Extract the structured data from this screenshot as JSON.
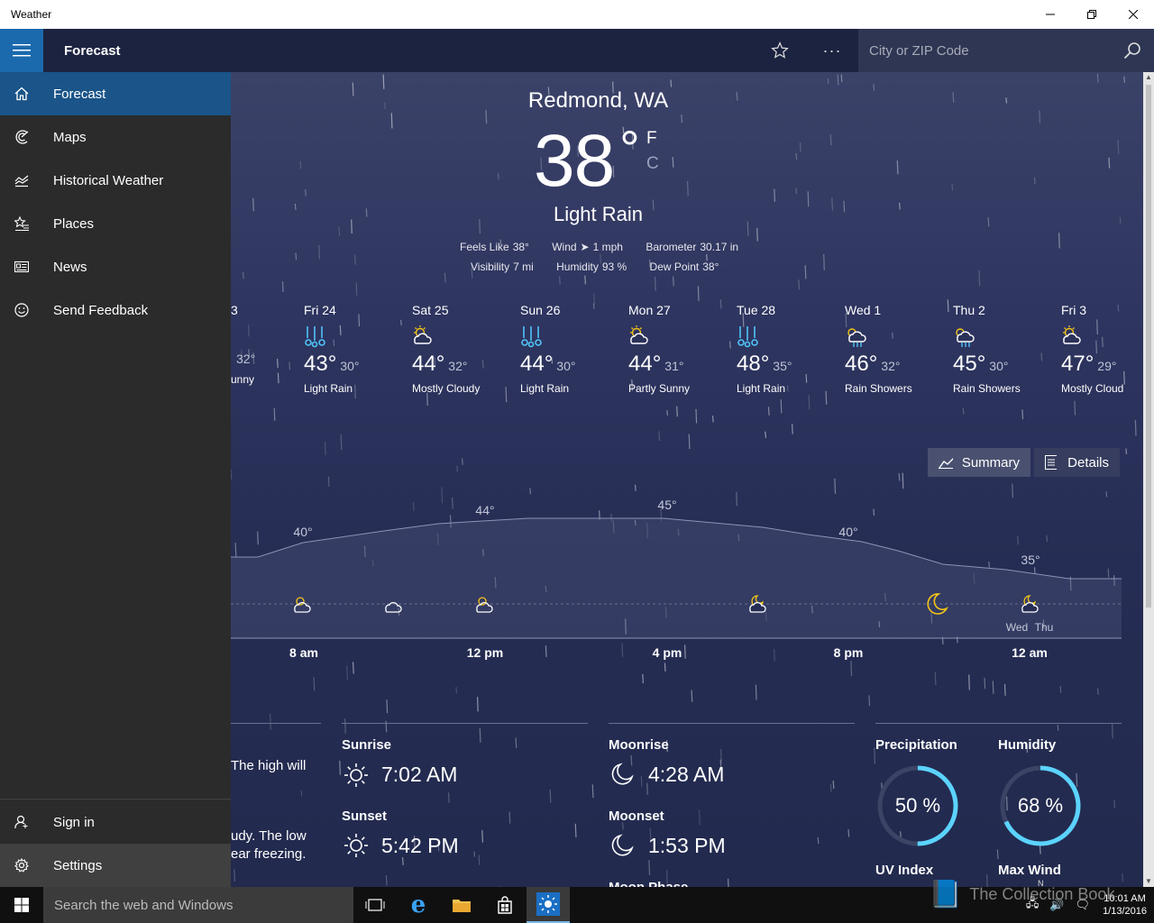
{
  "window": {
    "title": "Weather"
  },
  "header": {
    "title": "Forecast",
    "search_placeholder": "City or ZIP Code"
  },
  "nav": {
    "items": [
      {
        "label": "Forecast"
      },
      {
        "label": "Maps"
      },
      {
        "label": "Historical Weather"
      },
      {
        "label": "Places"
      },
      {
        "label": "News"
      },
      {
        "label": "Send Feedback"
      }
    ],
    "sign_in": "Sign in",
    "settings": "Settings"
  },
  "current": {
    "location": "Redmond, WA",
    "temperature": "38",
    "degree": "°",
    "unit_f": "F",
    "unit_c": "C",
    "condition": "Light Rain",
    "feels_like_label": "Feels Like",
    "feels_like": "38°",
    "wind_label": "Wind",
    "wind": "1 mph",
    "barometer_label": "Barometer",
    "barometer": "30.17 in",
    "visibility_label": "Visibility",
    "visibility": "7 mi",
    "humidity_label": "Humidity",
    "humidity": "93 %",
    "dew_point_label": "Dew Point",
    "dew_point": "38°"
  },
  "daily": [
    {
      "day": "3",
      "hi": "",
      "lo": "32°",
      "cond": "unny",
      "icon": "partly-sunny-icon"
    },
    {
      "day": "Fri 24",
      "hi": "43°",
      "lo": "30°",
      "cond": "Light Rain",
      "icon": "rain-icon"
    },
    {
      "day": "Sat 25",
      "hi": "44°",
      "lo": "32°",
      "cond": "Mostly Cloudy",
      "icon": "partly-cloudy-icon"
    },
    {
      "day": "Sun 26",
      "hi": "44°",
      "lo": "30°",
      "cond": "Light Rain",
      "icon": "rain-icon"
    },
    {
      "day": "Mon 27",
      "hi": "44°",
      "lo": "31°",
      "cond": "Partly Sunny",
      "icon": "partly-sunny-icon"
    },
    {
      "day": "Tue 28",
      "hi": "48°",
      "lo": "35°",
      "cond": "Light Rain",
      "icon": "rain-icon"
    },
    {
      "day": "Wed 1",
      "hi": "46°",
      "lo": "32°",
      "cond": "Rain Showers",
      "icon": "rain-showers-icon"
    },
    {
      "day": "Thu 2",
      "hi": "45°",
      "lo": "30°",
      "cond": "Rain Showers",
      "icon": "rain-showers-icon"
    },
    {
      "day": "Fri 3",
      "hi": "47°",
      "lo": "29°",
      "cond": "Mostly Cloud",
      "icon": "partly-cloudy-icon"
    }
  ],
  "toggle": {
    "summary": "Summary",
    "details": "Details"
  },
  "hourly": {
    "temp_labels": [
      "40°",
      "44°",
      "45°",
      "40°",
      "35°"
    ],
    "time_labels": [
      "8 am",
      "12 pm",
      "4 pm",
      "8 pm",
      "12 am"
    ],
    "day_change": [
      "Wed",
      "Thu"
    ]
  },
  "sun_moon": {
    "partial_text_1": "The high will",
    "partial_text_2": "udy. The low",
    "partial_text_3": "ear freezing.",
    "sunrise_label": "Sunrise",
    "sunrise": "7:02 AM",
    "sunset_label": "Sunset",
    "sunset": "5:42 PM",
    "moonrise_label": "Moonrise",
    "moonrise": "4:28 AM",
    "moonset_label": "Moonset",
    "moonset": "1:53 PM",
    "moon_phase_label": "Moon Phase"
  },
  "stats": {
    "precip_label": "Precipitation",
    "precip_value": "50 %",
    "precip_fraction": 0.5,
    "humidity_label": "Humidity",
    "humidity_value": "68 %",
    "humidity_fraction": 0.68,
    "uv_label": "UV Index",
    "wind_label": "Max Wind",
    "wind_dir": "N"
  },
  "taskbar": {
    "search": "Search the web and Windows",
    "time": "10:01 AM",
    "date": "1/13/2016"
  },
  "watermark": "The Collection Book",
  "colors": {
    "accent": "#1a5488",
    "gauge": "#5bd3ff",
    "icon_yellow": "#f5c518",
    "icon_rain": "#4fc3f7"
  }
}
